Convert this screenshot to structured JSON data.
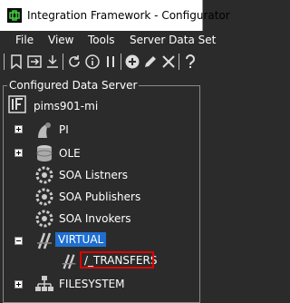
{
  "window": {
    "title": "Integration Framework - Configurator"
  },
  "menubar": {
    "items": [
      "File",
      "View",
      "Tools",
      "Server Data Set"
    ]
  },
  "toolbar": {
    "icons": [
      "bookmark-icon",
      "export-icon",
      "import-icon",
      "refresh-icon",
      "info-icon",
      "pause-icon",
      "add-icon",
      "edit-icon",
      "delete-icon",
      "help-icon"
    ]
  },
  "tree": {
    "group_label": "Configured Data Server",
    "root": {
      "label": "pims901-mi"
    },
    "nodes": [
      {
        "label": "PI",
        "expander": "+"
      },
      {
        "label": "OLE",
        "expander": "+"
      },
      {
        "label": "SOA Listners"
      },
      {
        "label": "SOA Publishers"
      },
      {
        "label": "SOA Invokers"
      },
      {
        "label": "VIRTUAL",
        "expander": "-",
        "selected": true
      },
      {
        "label": "/_TRANSFERS",
        "highlighted": true
      },
      {
        "label": "FILESYSTEM",
        "expander": "+"
      }
    ]
  },
  "colors": {
    "selection": "#1f6fd1",
    "highlight_border": "#e00000",
    "background": "#2b2b2b"
  }
}
